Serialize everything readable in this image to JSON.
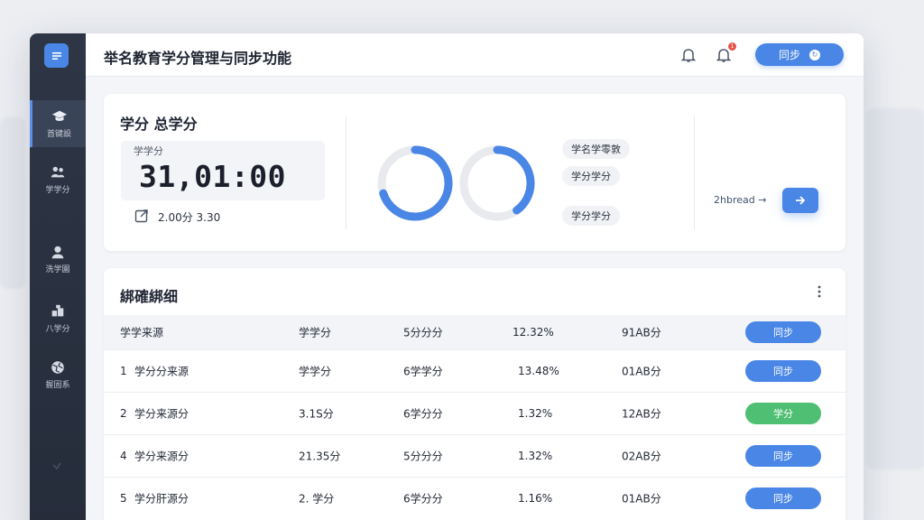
{
  "app": {
    "title": "举名教育学分管理与同步功能"
  },
  "header": {
    "sync_label": "同步",
    "notification_count": "1"
  },
  "sidebar": {
    "items": [
      {
        "label": "首键設",
        "icon": "graduation-cap-icon"
      },
      {
        "label": "学学分",
        "icon": "users-icon"
      },
      {
        "label": "洗学園",
        "icon": "person-icon"
      },
      {
        "label": "八学分",
        "icon": "blocks-icon"
      },
      {
        "label": "握固系",
        "icon": "globe-icon"
      }
    ]
  },
  "summary": {
    "title": "学分 总学分",
    "stat_label": "学学分",
    "stat_value": "31,01:00",
    "stat_sub": "2.00分 3.30",
    "donut1_percent": 70,
    "donut2_percent": 40,
    "pills": [
      "学名学零敦",
      "学分学分",
      "学分学分"
    ],
    "link_text": "2hbread →"
  },
  "detail": {
    "title": "綁確綁细",
    "header": [
      "学学来源",
      "学学分",
      "5分分分",
      "12.32%",
      "91AB分",
      "同步"
    ],
    "rows": [
      {
        "num": "1",
        "source": "学分分来源",
        "credit": "学学分",
        "type": "6学学分",
        "pct": "13.48%",
        "code": "01AB分",
        "action": "同步",
        "status": "blue"
      },
      {
        "num": "2",
        "source": "学分来源分",
        "credit": "3.1S分",
        "type": "6学分分",
        "pct": "1.32%",
        "code": "12AB分",
        "action": "学分",
        "status": "green"
      },
      {
        "num": "4",
        "source": "学分来源分",
        "credit": "21.35分",
        "type": "5分分分",
        "pct": "1.32%",
        "code": "02AB分",
        "action": "同步",
        "status": "blue"
      },
      {
        "num": "5",
        "source": "学分肝源分",
        "credit": "2. 学分",
        "type": "6学分分",
        "pct": "1.16%",
        "code": "01AB分",
        "action": "同步",
        "status": "blue"
      }
    ]
  },
  "colors": {
    "accent": "#4a86e6",
    "success": "#4fbf74",
    "sidebar": "#2a3140"
  }
}
